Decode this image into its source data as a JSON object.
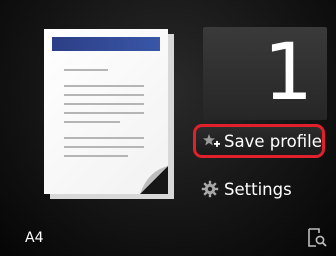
{
  "copies": {
    "value": "1"
  },
  "actions": {
    "save_profile_label": "Save profile",
    "settings_label": "Settings"
  },
  "paper": {
    "size_label": "A4"
  },
  "icons": {
    "save_profile": "plus-star-icon",
    "settings": "gear-icon",
    "preview": "preview-zoom-icon"
  },
  "colors": {
    "highlight_border": "#e0212b",
    "header_band": "#2c3f86"
  }
}
